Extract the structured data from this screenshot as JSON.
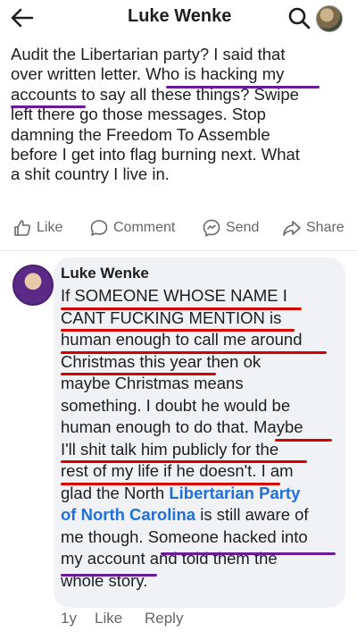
{
  "header": {
    "title": "Luke Wenke",
    "back_icon": "arrow-left-icon",
    "search_icon": "search-icon"
  },
  "post": {
    "lines": [
      "Audit the Libertarian party?  I said that",
      "over written letter.  Who is hacking my",
      "accounts to say all these things?  Swipe",
      "left there go those messages.  Stop",
      "damning the Freedom To Assemble",
      "before I get into flag burning next.  What",
      "a shit country I live in."
    ]
  },
  "actions": {
    "like": "Like",
    "comment": "Comment",
    "send": "Send",
    "share": "Share"
  },
  "comment": {
    "author": "Luke Wenke",
    "lines": [
      "If SOMEONE WHOSE NAME I",
      "CANT FUCKING MENTION is",
      "human enough to call me around",
      "Christmas this year then ok",
      "maybe Christmas means",
      "something.  I doubt he would be",
      "human enough to do that.  Maybe",
      "I'll shit talk him publicly for the",
      "rest of my life if he doesn't.  I am",
      "glad the North ",
      "Libertarian Party",
      "of North Carolina",
      " is still aware of",
      "me though.  Someone hacked into",
      "my account and told them the",
      "whole story."
    ],
    "age": "1y",
    "like": "Like",
    "reply": "Reply"
  },
  "colors": {
    "link": "#216fdb",
    "underline_red": "#d50000",
    "underline_purple": "#6a1b9a",
    "bubble": "#f0f2f5",
    "muted": "#65676b"
  }
}
